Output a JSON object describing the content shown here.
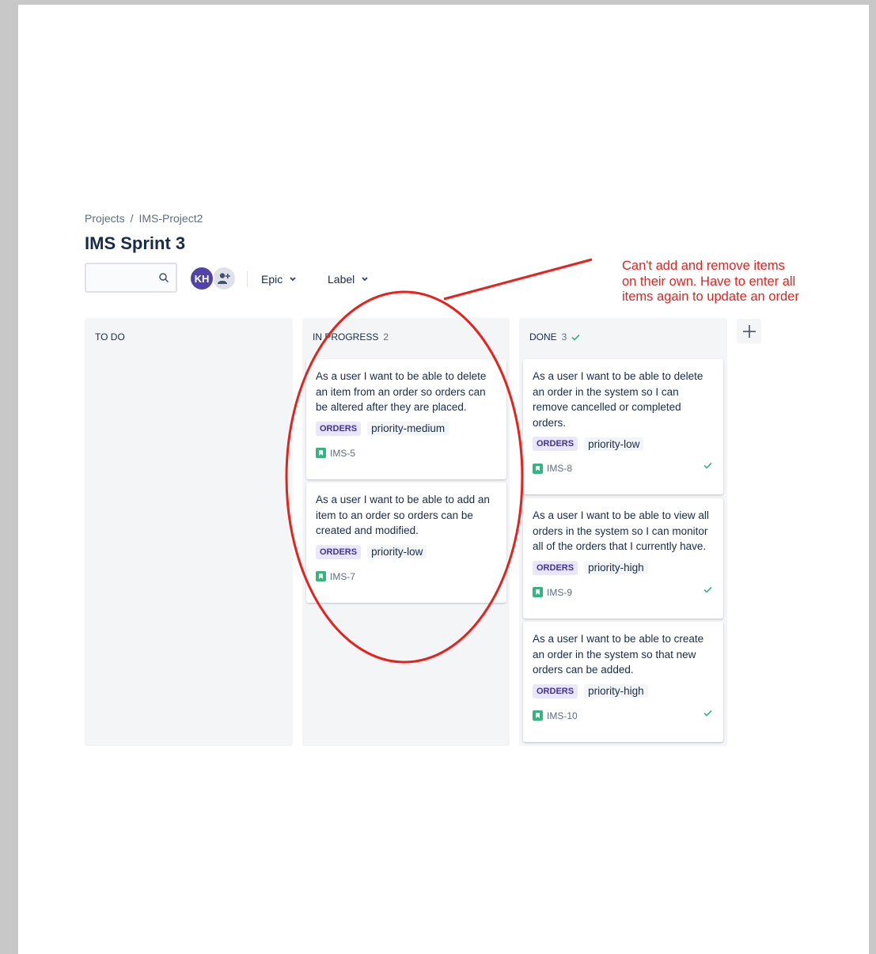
{
  "breadcrumb": {
    "projects": "Projects",
    "separator": "/",
    "project": "IMS-Project2"
  },
  "board": {
    "title": "IMS Sprint 3"
  },
  "toolbar": {
    "avatar_initials": "KH",
    "epic_filter": "Epic",
    "label_filter": "Label"
  },
  "columns": {
    "todo": {
      "title": "TO DO"
    },
    "in_progress": {
      "title": "IN PROGRESS",
      "count": "2"
    },
    "done": {
      "title": "DONE",
      "count": "3"
    }
  },
  "cards": {
    "ims5": {
      "summary": "As a user I want to be able to delete an item from an order so orders can be altered after they are placed.",
      "epic": "ORDERS",
      "label": "priority-medium",
      "key": "IMS-5"
    },
    "ims7": {
      "summary": "As a user I want to be able to add an item to an order so orders can be created and modified.",
      "epic": "ORDERS",
      "label": "priority-low",
      "key": "IMS-7"
    },
    "ims8": {
      "summary": "As a user I want to be able to delete an order in the system so I can remove cancelled or completed orders.",
      "epic": "ORDERS",
      "label": "priority-low",
      "key": "IMS-8"
    },
    "ims9": {
      "summary": "As a user I want to be able to view all orders in the system so I can monitor all of the orders that I currently have.",
      "epic": "ORDERS",
      "label": "priority-high",
      "key": "IMS-9"
    },
    "ims10": {
      "summary": "As a user I want to be able to create an order in the system so that new orders can be added.",
      "epic": "ORDERS",
      "label": "priority-high",
      "key": "IMS-10"
    }
  },
  "annotation": {
    "text": "Can't add and remove items\non their own. Have to enter all\nitems again to update an order",
    "color": "#e8211d"
  },
  "colors": {
    "epic_bg": "#eae6ff",
    "epic_text": "#403294",
    "story": "#36b37e",
    "avatar": "#5243aa"
  }
}
